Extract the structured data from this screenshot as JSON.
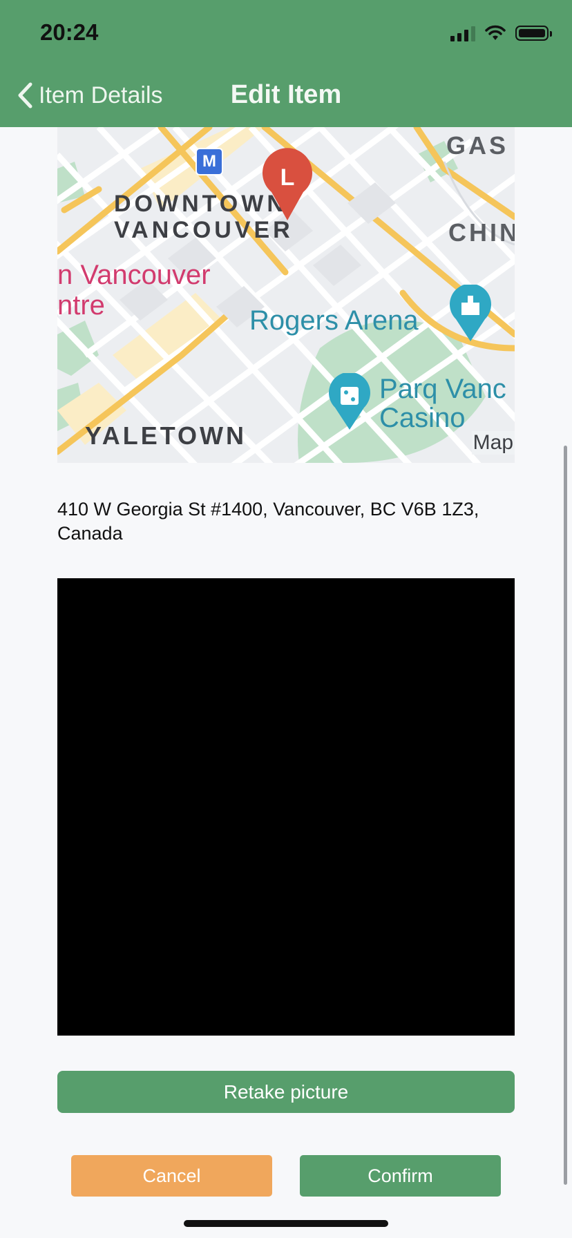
{
  "status_bar": {
    "time": "20:24"
  },
  "nav": {
    "back_label": "Item Details",
    "title": "Edit Item"
  },
  "map": {
    "labels": {
      "downtown_line1": "DOWNTOWN",
      "downtown_line2": "VANCOUVER",
      "vancouver_centre_line1": "n Vancouver",
      "vancouver_centre_line2": "ntre",
      "rogers_arena": "Rogers Arena",
      "parq_line1": "Parq Vanc",
      "parq_line2": "Casino",
      "yaletown": "YALETOWN",
      "gastown": "GAS",
      "chinatown": "CHIN",
      "metro_badge": "M",
      "pin_letter": "L",
      "attribution": "Map"
    },
    "colors": {
      "road": "#f5c55a",
      "park": "#bfe0c8",
      "pin": "#d9503f",
      "poi": "#2fa8c4",
      "label_pink": "#d23b6e",
      "label_teal": "#2d8fa8"
    }
  },
  "address": "410 W Georgia St #1400, Vancouver, BC V6B 1Z3, Canada",
  "actions": {
    "retake": "Retake picture",
    "cancel": "Cancel",
    "confirm": "Confirm"
  },
  "colors": {
    "primary": "#579e6c",
    "cancel": "#f0a75c"
  }
}
